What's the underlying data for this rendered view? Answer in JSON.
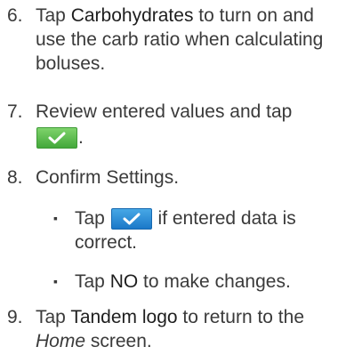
{
  "steps": [
    {
      "number": "6.",
      "text": {
        "before": "Tap ",
        "bold": "Carbohydrates",
        "after_line1": " to turn on and",
        "line2": "use the carb ratio when calculating",
        "line3": "boluses."
      }
    },
    {
      "number": "7.",
      "text": {
        "line1": "Review entered values and tap",
        "after_icon": "."
      },
      "icon": "checkmark-icon"
    },
    {
      "number": "8.",
      "text": {
        "line1": "Confirm Settings."
      },
      "subitems": [
        {
          "bullet": "▪",
          "before": "Tap ",
          "after": " if entered data is",
          "line2": "correct.",
          "icon": "checkmark-icon"
        },
        {
          "bullet": "▪",
          "before": "Tap ",
          "bold": "NO",
          "after": " to make changes."
        }
      ]
    },
    {
      "number": "9.",
      "text": {
        "before": "Tap ",
        "bold": "Tandem logo",
        "after_line1": " to return to the",
        "italic": "Home",
        "after_italic": " screen."
      }
    }
  ],
  "colors": {
    "text": "#3a3a3a",
    "green_button": "#55b848",
    "blue_button": "#2a8ad6"
  }
}
